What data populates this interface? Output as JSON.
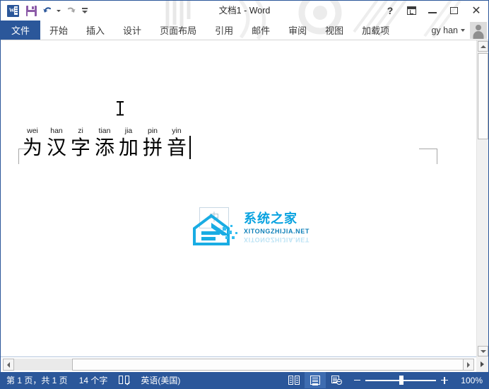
{
  "window": {
    "title": "文档1 - Word",
    "help_label": "?",
    "ribbon_options_label": "ribbon-display-options",
    "minimize_label": "minimize",
    "maximize_label": "maximize",
    "close_label": "✕"
  },
  "quick_access": {
    "items": [
      {
        "name": "word-logo-icon",
        "label": "W"
      },
      {
        "name": "save-icon",
        "label": "保存"
      },
      {
        "name": "undo-icon",
        "label": "撤消"
      },
      {
        "name": "redo-icon",
        "label": "恢复"
      },
      {
        "name": "customize-qat-icon",
        "label": "自定义快速访问工具栏"
      }
    ]
  },
  "ribbon": {
    "tabs": [
      {
        "label": "文件",
        "active": true
      },
      {
        "label": "开始",
        "active": false
      },
      {
        "label": "插入",
        "active": false
      },
      {
        "label": "设计",
        "active": false
      },
      {
        "label": "页面布局",
        "active": false
      },
      {
        "label": "引用",
        "active": false
      },
      {
        "label": "邮件",
        "active": false
      },
      {
        "label": "审阅",
        "active": false
      },
      {
        "label": "视图",
        "active": false
      },
      {
        "label": "加载项",
        "active": false
      }
    ]
  },
  "account": {
    "name": "gy han"
  },
  "document": {
    "ruby": [
      {
        "pinyin": "wei",
        "han": "为"
      },
      {
        "pinyin": "han",
        "han": "汉"
      },
      {
        "pinyin": "zi",
        "han": "字"
      },
      {
        "pinyin": "tian",
        "han": "添"
      },
      {
        "pinyin": "jia",
        "han": "加"
      },
      {
        "pinyin": "pin",
        "han": "拼"
      },
      {
        "pinyin": "yin",
        "han": "音"
      }
    ],
    "full_text": "为汉字添加拼音"
  },
  "watermark": {
    "badge": "中",
    "brand_cn": "系统之家",
    "brand_en": "XITONGZHIJIA.NET"
  },
  "status_bar": {
    "page_info": "第 1 页，共 1 页",
    "word_count": "14 个字",
    "proofing_icon_label": "校对",
    "language": "英语(美国)",
    "views": [
      {
        "name": "read-mode-view-button",
        "label": "阅读视图",
        "active": false
      },
      {
        "name": "print-layout-view-button",
        "label": "页面视图",
        "active": true
      },
      {
        "name": "web-layout-view-button",
        "label": "Web 版式视图",
        "active": false
      }
    ],
    "zoom_out_label": "缩小",
    "zoom_in_label": "放大",
    "zoom_level": "100%"
  },
  "colors": {
    "word_blue": "#2b579a",
    "status_bar": "#2b579a",
    "save_purple": "#8c5ba8",
    "brand_cyan": "#0aa3e0"
  }
}
